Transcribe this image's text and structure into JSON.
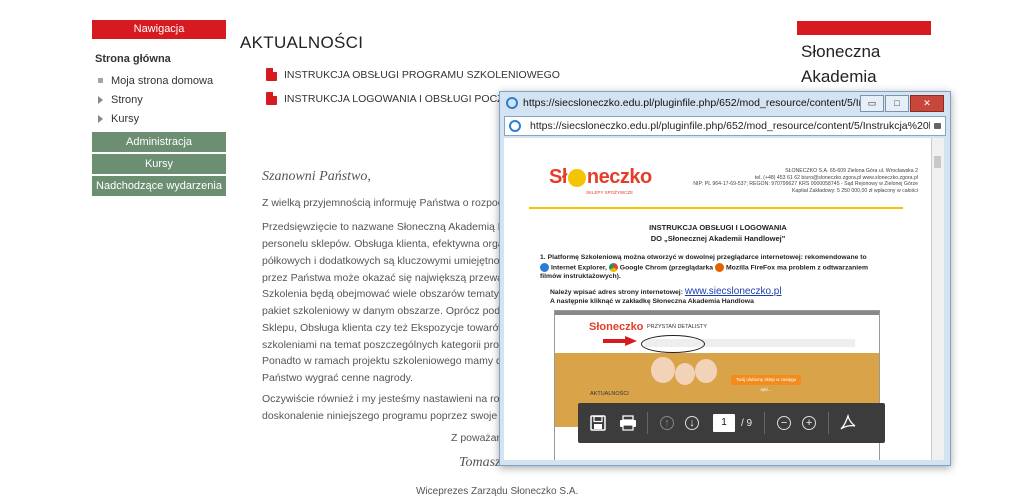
{
  "nav": {
    "header": "Nawigacja",
    "home": "Strona główna",
    "items": [
      "Moja strona domowa",
      "Strony",
      "Kursy"
    ],
    "blocks": [
      "Administracja",
      "Kursy",
      "Nadchodzące wydarzenia"
    ]
  },
  "main": {
    "title": "AKTUALNOŚCI",
    "links": [
      "INSTRUKCJA OBSŁUGI PROGRAMU SZKOLENIOWEGO",
      "INSTRUKCJA LOGOWANIA I OBSŁUGI POCZTY"
    ],
    "greeting": "Szanowni Państwo,",
    "paragraphs": [
      [
        "Z wielką przyjemnością informuję Państwa o rozpocz"
      ],
      [
        "Przedsięwzięcie to nazwane Słoneczną Akademią Han",
        "personelu sklepów. Obsługa klienta, efektywna organ",
        "półkowych i dodatkowych są kluczowymi umiejętnośc",
        "przez Państwa może okazać się największą przewaga"
      ],
      [
        "Szkolenia będą obejmować wiele obszarów tematycz",
        "pakiet szkoleniowy w danym obszarze. Oprócz podst",
        "Sklepu, Obsługa klienta czy też Ekspozycje towarów n",
        "szkoleniami na temat poszczególnych kategorii produ"
      ],
      [
        "Ponadto w ramach projektu szkoleniowego mamy dl",
        "Państwo wygrać cenne nagrody."
      ],
      [
        "Oczywiście również i my jesteśmy nastawieni na rozw",
        "doskonalenie niniejszego programu poprzez swoje o"
      ]
    ],
    "regards": "Z poważan",
    "signature": "Tomasz Wilkoń",
    "role": "Wiceprezes Zarządu Słoneczko S.A."
  },
  "right": {
    "title_line1": "Słoneczna",
    "title_line2": "Akademia"
  },
  "popup": {
    "title": "https://siecsloneczko.edu.pl/pluginfile.php/652/mod_resource/content/5/Instru...",
    "address": "https://siecsloneczko.edu.pl/pluginfile.php/652/mod_resource/content/5/Instrukcja%20logowan",
    "win_buttons": [
      "▭",
      "□",
      "✕"
    ],
    "pdf": {
      "logo_left": "Sł",
      "logo_right": "neczko",
      "logo_sub": "SKLEPY SPOŻYWCZE",
      "company_lines": [
        "SŁONECZKO S.A. 65-609 Zielona Góra ul. Wrocławska 2",
        "tel. (+48) 453 61 62 biuro@sloneczko.zgora.pl www.sloneczko.zgora.pl",
        "NIP: PL 964-17-69-537; REGON: 970799627 KRS 0000058745 - Sąd Rejonowy w Zielonej Górze",
        "Kapitał Zakładowy: 5 250 000,00 zł wpłacony w całości"
      ],
      "heading1": "INSTRUKCJA OBSŁUGI I LOGOWANIA",
      "heading2": "DO „Słonecznej Akademii Handlowej\"",
      "step_num": "1.",
      "step_text_a": "Platformę Szkoleniową można otworzyć w dowolnej przeglądarce internetowej: rekomendowane to",
      "step_text_b": "Internet Explorer,",
      "step_text_c": "Google Chrom (przeglądarka",
      "step_text_d": "Mozilla FireFox ma problem z odtwarzaniem",
      "step_text_e": "filmów instruktażowych).",
      "url_label": "Należy wpisać adres strony internetowej:",
      "url": "www.siecsloneczko.pl",
      "next_step": "A następnie kliknąć w zakładkę Słoneczna Akademia Handlowa",
      "shot_logo": "Słoneczko",
      "shot_menu": "PRZYSTAŃ DETALISTY",
      "shot_cta": "Twój ulubiony sklep w zasięgu ręki...",
      "shot_section": "AKTUALNOŚCI"
    },
    "toolbar": {
      "page": "1",
      "total": "/ 9"
    }
  }
}
